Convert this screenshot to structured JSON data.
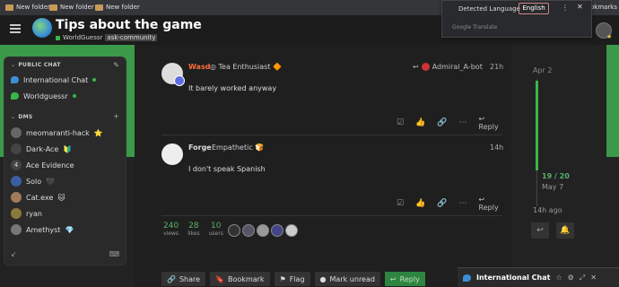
{
  "bookmarks": [
    "New folder",
    "New folder",
    "New folder"
  ],
  "bookmarks_right": "bookmarks",
  "header": {
    "title": "Tips about the game",
    "category": "WorldGuessr",
    "tag": "ask-community"
  },
  "translate": {
    "detected": "Detected Language",
    "english": "English",
    "menu": "⋮",
    "close": "✕",
    "google": "Google Translate"
  },
  "sidebar": {
    "public_chat": "PUBLIC CHAT",
    "channels": [
      {
        "label": "International Chat",
        "color": "#3a8fd6"
      },
      {
        "label": "Worldguessr",
        "color": "#3ab54a"
      }
    ],
    "dms": "DMS",
    "dm_items": [
      {
        "label": "meomaranti-hack",
        "badge": "⭐",
        "avatar": ""
      },
      {
        "label": "Dark-Ace",
        "badge": "🔰",
        "avatar": ""
      },
      {
        "label": "Ace Evidence",
        "badge": "",
        "avatar": "4"
      },
      {
        "label": "Solo",
        "badge": "🖤",
        "avatar": ""
      },
      {
        "label": "Cat.exe",
        "badge": "🐱",
        "avatar": ""
      },
      {
        "label": "ryan",
        "badge": "",
        "avatar": ""
      },
      {
        "label": "Amethyst",
        "badge": "💎",
        "avatar": ""
      }
    ]
  },
  "posts": [
    {
      "username": "Wasd",
      "user_color": "#ff6b3b",
      "title": "Tea Enthusiast",
      "title_badge": "🔶",
      "reply_to": "Admiral_A-bot",
      "time": "21h",
      "text": "It barely worked anyway",
      "reply": "Reply"
    },
    {
      "username": "Forge",
      "user_color": "#dddddd",
      "title": "Empathetic",
      "title_badge": "🍞",
      "reply_to": "",
      "time": "14h",
      "text": "I don't speak Spanish",
      "reply": "Reply"
    }
  ],
  "stats": [
    {
      "n": "240",
      "l": "views"
    },
    {
      "n": "28",
      "l": "likes"
    },
    {
      "n": "10",
      "l": "users"
    }
  ],
  "bottom_buttons": [
    "Share",
    "Bookmark",
    "Flag",
    "Mark unread",
    "Reply"
  ],
  "timeline": {
    "start": "Apr 2",
    "position": "19 / 20",
    "date": "May 7",
    "end": "14h ago"
  },
  "chat_float": {
    "title": "International Chat"
  },
  "colors": {
    "accent": "#3ab54a",
    "header": "#1c1c1c",
    "bg": "#1f1f1f"
  }
}
